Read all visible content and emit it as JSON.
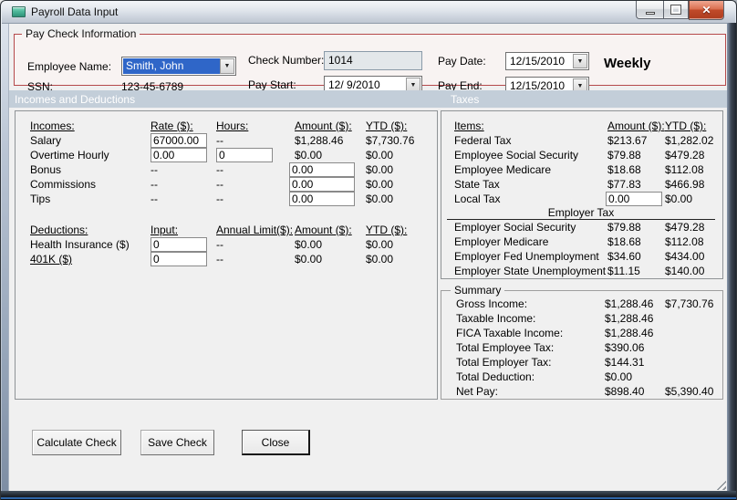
{
  "window": {
    "title": "Payroll Data Input",
    "close_glyph": "✕"
  },
  "paycheck": {
    "group_label": "Pay Check Information",
    "employee_name": {
      "label": "Employee Name:",
      "value": "Smith, John"
    },
    "ssn": {
      "label": "SSN:",
      "value": "123-45-6789"
    },
    "check_number": {
      "label": "Check Number:",
      "value": "1014"
    },
    "pay_start": {
      "label": "Pay Start:",
      "value": "12/ 9/2010"
    },
    "pay_date": {
      "label": "Pay Date:",
      "value": "12/15/2010"
    },
    "pay_end": {
      "label": "Pay End:",
      "value": "12/15/2010"
    },
    "frequency": "Weekly"
  },
  "section_headers": {
    "left": "Incomes and Deductions",
    "right": "Taxes"
  },
  "incomes": {
    "headers": {
      "item": "Incomes:",
      "rate": "Rate ($):",
      "hours": "Hours:",
      "amount": "Amount ($):",
      "ytd": "YTD ($):"
    },
    "rows": [
      {
        "label": "Salary",
        "rate": "67000.00",
        "hours": "--",
        "amount": "$1,288.46",
        "ytd": "$7,730.76"
      },
      {
        "label": "Overtime Hourly",
        "rate": "0.00",
        "hours": "0",
        "amount": "$0.00",
        "ytd": "$0.00"
      },
      {
        "label": "Bonus",
        "rate": "--",
        "hours": "--",
        "amount": "0.00",
        "ytd": "$0.00"
      },
      {
        "label": "Commissions",
        "rate": "--",
        "hours": "--",
        "amount": "0.00",
        "ytd": "$0.00"
      },
      {
        "label": "Tips",
        "rate": "--",
        "hours": "--",
        "amount": "0.00",
        "ytd": "$0.00"
      }
    ]
  },
  "deductions": {
    "headers": {
      "item": "Deductions:",
      "input": "Input:",
      "limit": "Annual Limit($):",
      "amount": "Amount ($):",
      "ytd": "YTD ($):"
    },
    "rows": [
      {
        "label": "Health Insurance ($)",
        "input": "0",
        "limit": "--",
        "amount": "$0.00",
        "ytd": "$0.00"
      },
      {
        "label": "401K ($)",
        "input": "0",
        "limit": "--",
        "amount": "$0.00",
        "ytd": "$0.00"
      }
    ]
  },
  "taxes": {
    "headers": {
      "item": "Items:",
      "amount": "Amount ($):",
      "ytd": "YTD ($):"
    },
    "employee_rows": [
      {
        "label": "Federal Tax",
        "amount": "$213.67",
        "ytd": "$1,282.02"
      },
      {
        "label": "Employee Social Security",
        "amount": "$79.88",
        "ytd": "$479.28"
      },
      {
        "label": "Employee Medicare",
        "amount": "$18.68",
        "ytd": "$112.08"
      },
      {
        "label": "State Tax",
        "amount": "$77.83",
        "ytd": "$466.98"
      },
      {
        "label": "Local Tax",
        "amount": "0.00",
        "ytd": "$0.00"
      }
    ],
    "employer_header": "Employer Tax",
    "employer_rows": [
      {
        "label": "Employer Social Security",
        "amount": "$79.88",
        "ytd": "$479.28"
      },
      {
        "label": "Employer Medicare",
        "amount": "$18.68",
        "ytd": "$112.08"
      },
      {
        "label": "Employer Fed Unemployment",
        "amount": "$34.60",
        "ytd": "$434.00"
      },
      {
        "label": "Employer State Unemployment",
        "amount": "$11.15",
        "ytd": "$140.00"
      }
    ]
  },
  "summary": {
    "group_label": "Summary",
    "rows": [
      {
        "label": "Gross Income:",
        "amount": "$1,288.46",
        "ytd": "$7,730.76"
      },
      {
        "label": "Taxable Income:",
        "amount": "$1,288.46",
        "ytd": ""
      },
      {
        "label": "FICA Taxable Income:",
        "amount": "$1,288.46",
        "ytd": ""
      },
      {
        "label": "Total Employee Tax:",
        "amount": "$390.06",
        "ytd": ""
      },
      {
        "label": "Total Employer Tax:",
        "amount": "$144.31",
        "ytd": ""
      },
      {
        "label": "Total Deduction:",
        "amount": "$0.00",
        "ytd": ""
      },
      {
        "label": "Net Pay:",
        "amount": "$898.40",
        "ytd": "$5,390.40"
      }
    ]
  },
  "buttons": {
    "calculate": "Calculate Check",
    "save": "Save Check",
    "close": "Close"
  },
  "colors": {
    "section_bar": "#c3ced9",
    "paycheck_border_red": "#b5494b",
    "selection_blue": "#2f66c8",
    "close_button_red": "#c04a2a"
  }
}
